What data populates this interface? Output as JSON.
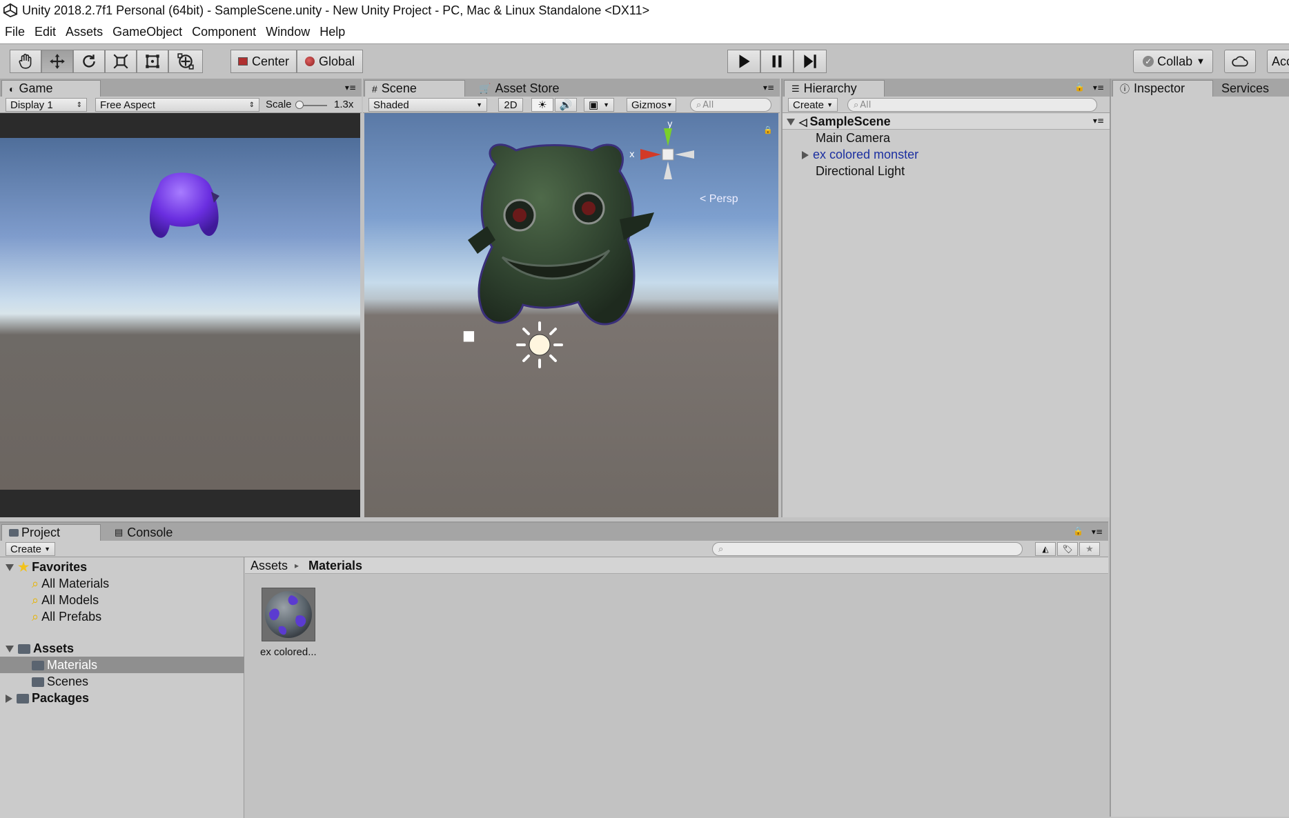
{
  "window": {
    "title": "Unity 2018.2.7f1 Personal (64bit) - SampleScene.unity - New Unity Project - PC, Mac & Linux Standalone <DX11>"
  },
  "menu": [
    "File",
    "Edit",
    "Assets",
    "GameObject",
    "Component",
    "Window",
    "Help"
  ],
  "toolbar": {
    "pivot_label": "Center",
    "space_label": "Global",
    "collab_label": "Collab",
    "account_label": "Acc"
  },
  "game": {
    "tab": "Game",
    "display": "Display 1",
    "aspect": "Free Aspect",
    "scale_label": "Scale",
    "scale_value": "1.3x"
  },
  "scene": {
    "tab": "Scene",
    "asset_store_tab": "Asset Store",
    "shading": "Shaded",
    "mode_2d": "2D",
    "gizmos": "Gizmos",
    "search_placeholder": "All",
    "persp_label": "< Persp",
    "axis_y": "y",
    "axis_x": "x"
  },
  "hierarchy": {
    "tab": "Hierarchy",
    "create": "Create",
    "search_placeholder": "All",
    "scene_name": "SampleScene",
    "items": [
      "Main Camera",
      "ex colored monster",
      "Directional Light"
    ]
  },
  "inspector": {
    "tab": "Inspector",
    "services_tab": "Services"
  },
  "project": {
    "tab": "Project",
    "console_tab": "Console",
    "create": "Create",
    "favorites": "Favorites",
    "fav_items": [
      "All Materials",
      "All Models",
      "All Prefabs"
    ],
    "assets": "Assets",
    "asset_folders": [
      "Materials",
      "Scenes"
    ],
    "packages": "Packages",
    "breadcrumb_root": "Assets",
    "breadcrumb_current": "Materials",
    "asset_item": "ex colored..."
  }
}
